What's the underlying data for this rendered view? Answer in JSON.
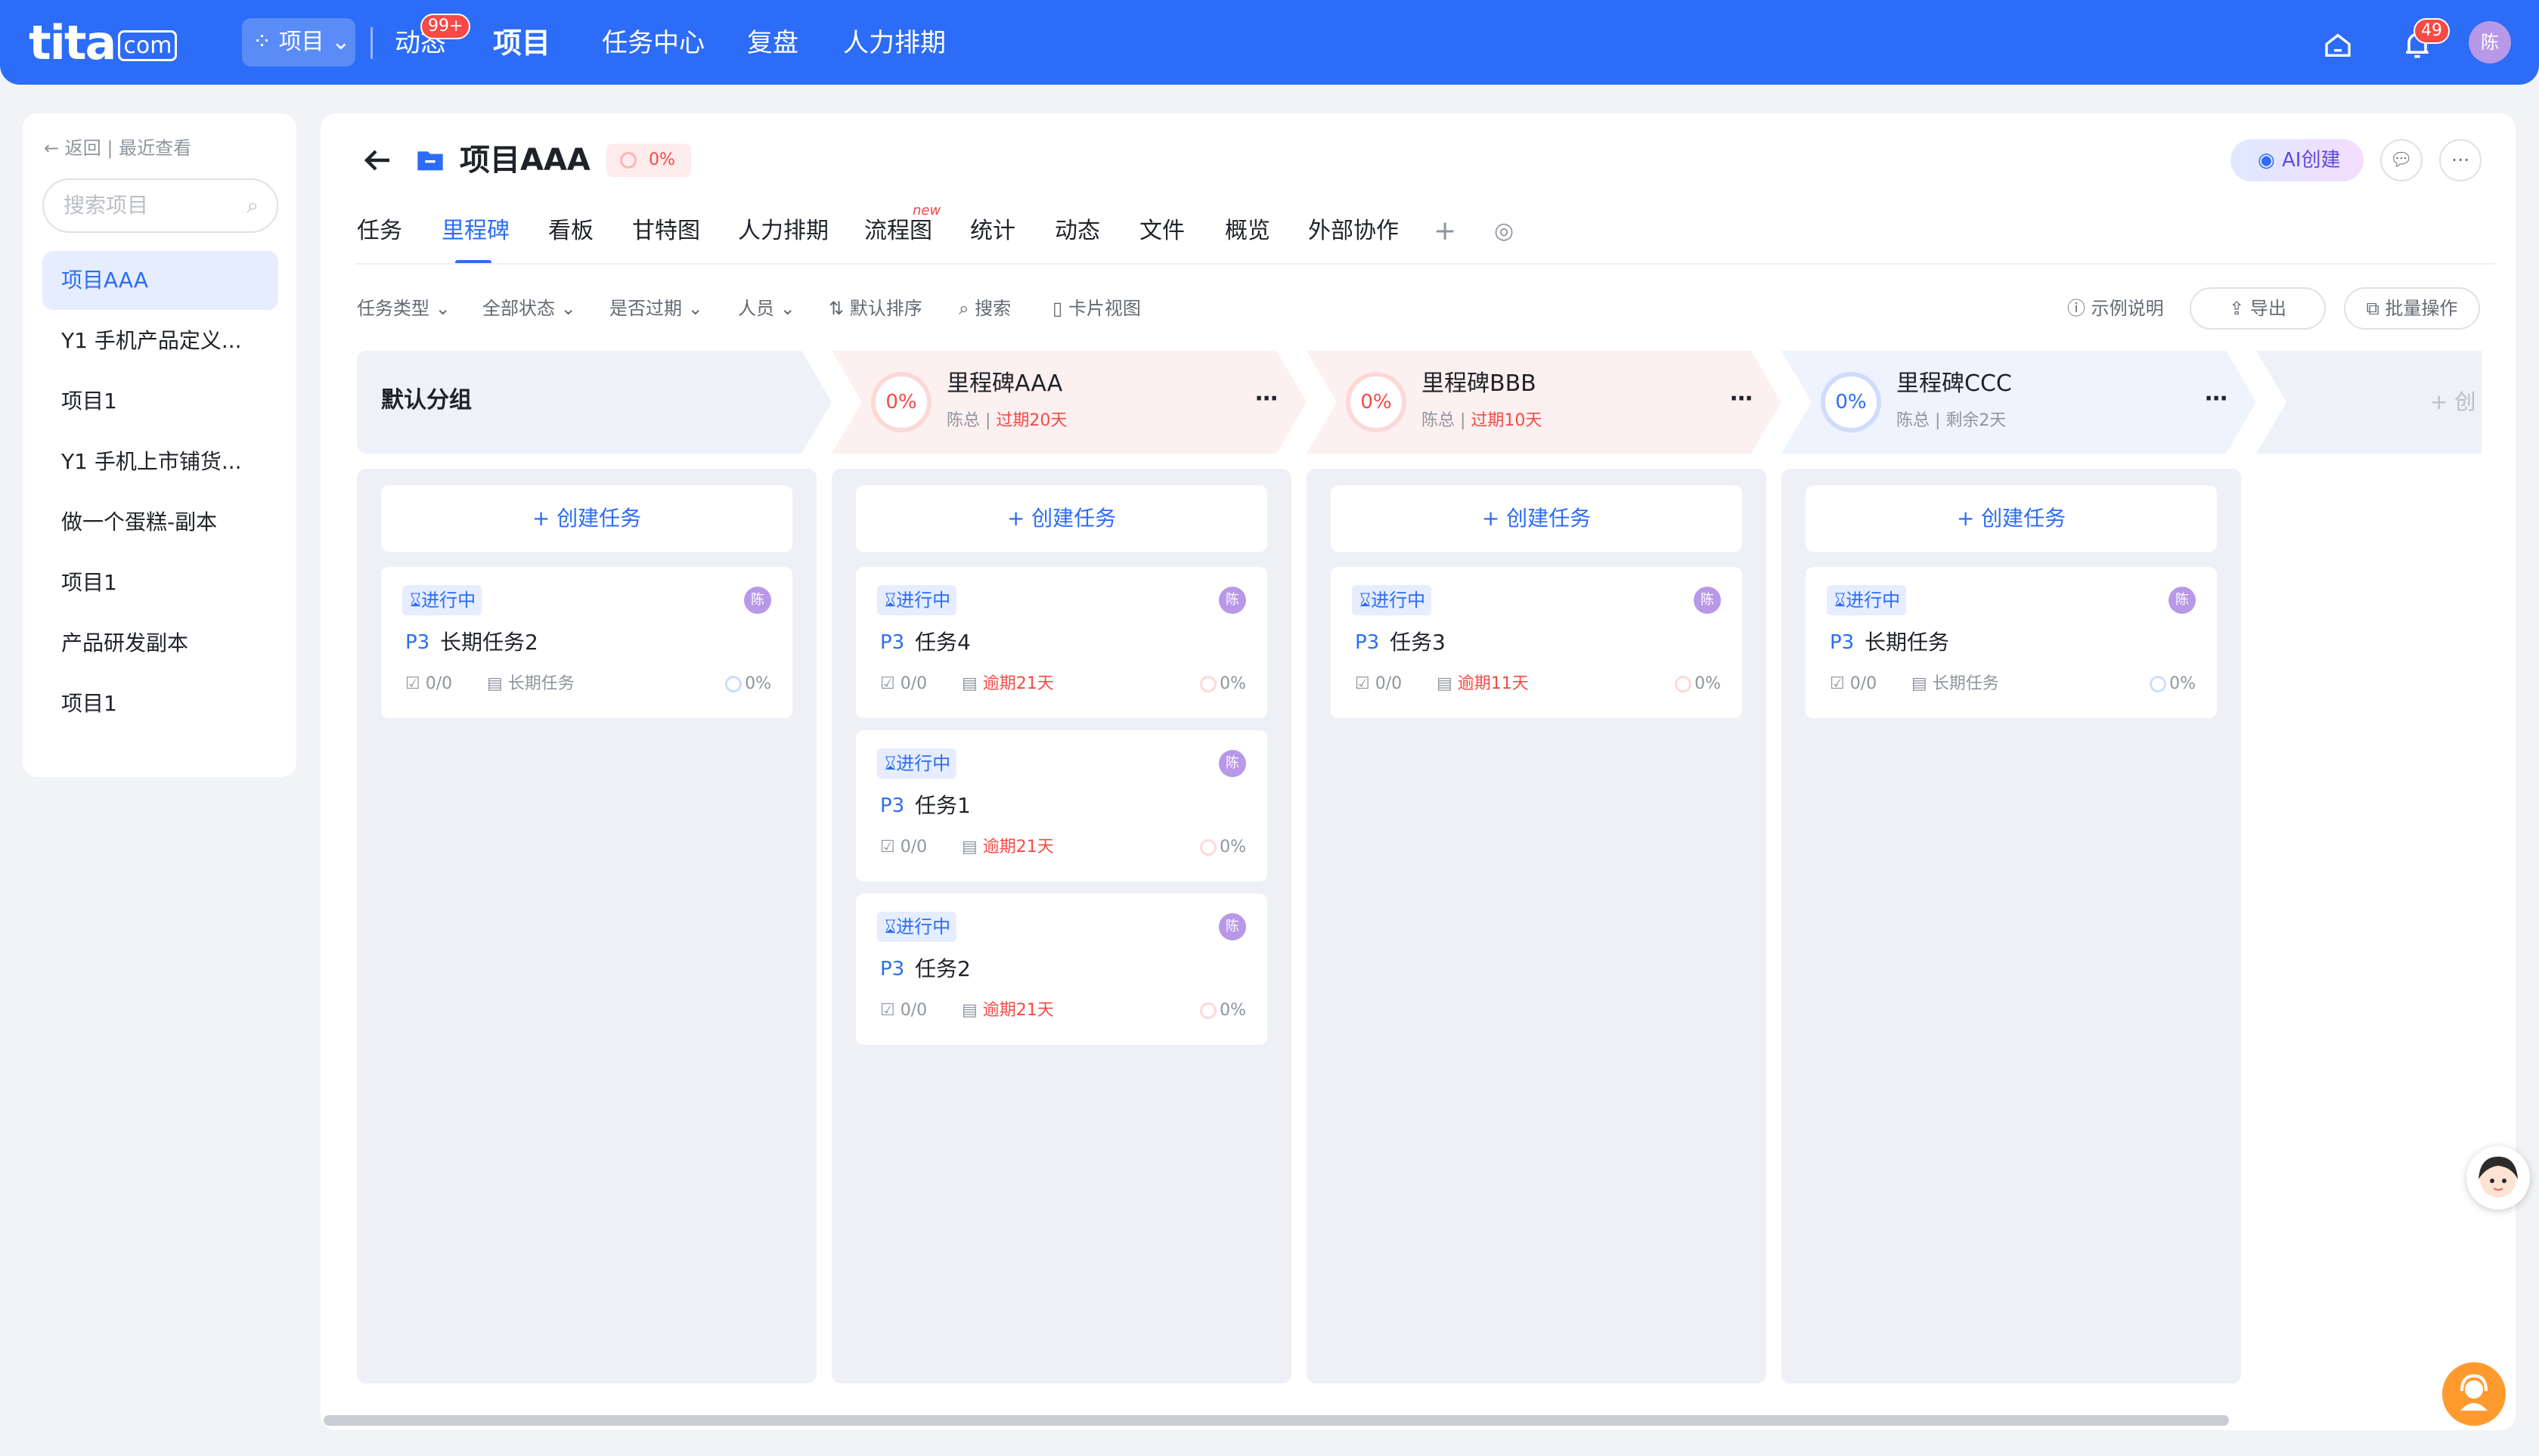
{
  "topbar": {
    "logo": "tita",
    "logo_suffix": "com",
    "project_switch": "项目",
    "nav": [
      {
        "label": "动态",
        "badge": "99+"
      },
      {
        "label": "项目"
      },
      {
        "label": "任务中心"
      },
      {
        "label": "复盘"
      },
      {
        "label": "人力排期"
      }
    ],
    "bell_badge": "49",
    "avatar": "陈"
  },
  "sidebar": {
    "back": "返回",
    "recent": "最近查看",
    "search_placeholder": "搜索项目",
    "items": [
      {
        "label": "项目AAA",
        "active": true
      },
      {
        "label": "Y1 手机产品定义..."
      },
      {
        "label": "项目1"
      },
      {
        "label": "Y1 手机上市铺货..."
      },
      {
        "label": "做一个蛋糕-副本"
      },
      {
        "label": "项目1"
      },
      {
        "label": "产品研发副本"
      },
      {
        "label": "项目1"
      }
    ]
  },
  "header": {
    "title": "项目AAA",
    "progress": "0%",
    "ai_button": "AI创建",
    "tabs": [
      "任务",
      "里程碑",
      "看板",
      "甘特图",
      "人力排期",
      "流程图",
      "统计",
      "动态",
      "文件",
      "概览",
      "外部协作"
    ],
    "active_tab": "里程碑",
    "new_tag": "new"
  },
  "filters": {
    "task_type": "任务类型",
    "all_status": "全部状态",
    "overdue": "是否过期",
    "people": "人员",
    "sort": "默认排序",
    "search": "搜索",
    "card_view": "卡片视图",
    "example": "示例说明",
    "export": "导出",
    "batch": "批量操作"
  },
  "columns": {
    "default_group": "默认分组",
    "create_label": "+ 创建任务",
    "add_partial": "+ 创",
    "milestones": [
      {
        "name": "里程碑AAA",
        "progress": "0%",
        "owner": "陈总",
        "state": "过期20天",
        "overdue": true,
        "color": "#f54a45"
      },
      {
        "name": "里程碑BBB",
        "progress": "0%",
        "owner": "陈总",
        "state": "过期10天",
        "overdue": true,
        "color": "#f54a45"
      },
      {
        "name": "里程碑CCC",
        "progress": "0%",
        "owner": "陈总",
        "state": "剩余2天",
        "overdue": false,
        "color": "#2c6cf6"
      }
    ]
  },
  "cards": {
    "status": "进行中",
    "priority": "P3",
    "check": "0/0",
    "pct": "0%",
    "avatar": "陈",
    "col0": [
      {
        "name": "长期任务2",
        "date": "长期任务"
      }
    ],
    "col1": [
      {
        "name": "任务4",
        "date": "逾期21天"
      },
      {
        "name": "任务1",
        "date": "逾期21天"
      },
      {
        "name": "任务2",
        "date": "逾期21天"
      }
    ],
    "col2": [
      {
        "name": "任务3",
        "date": "逾期11天"
      }
    ],
    "col3": [
      {
        "name": "长期任务",
        "date": "长期任务"
      }
    ]
  }
}
